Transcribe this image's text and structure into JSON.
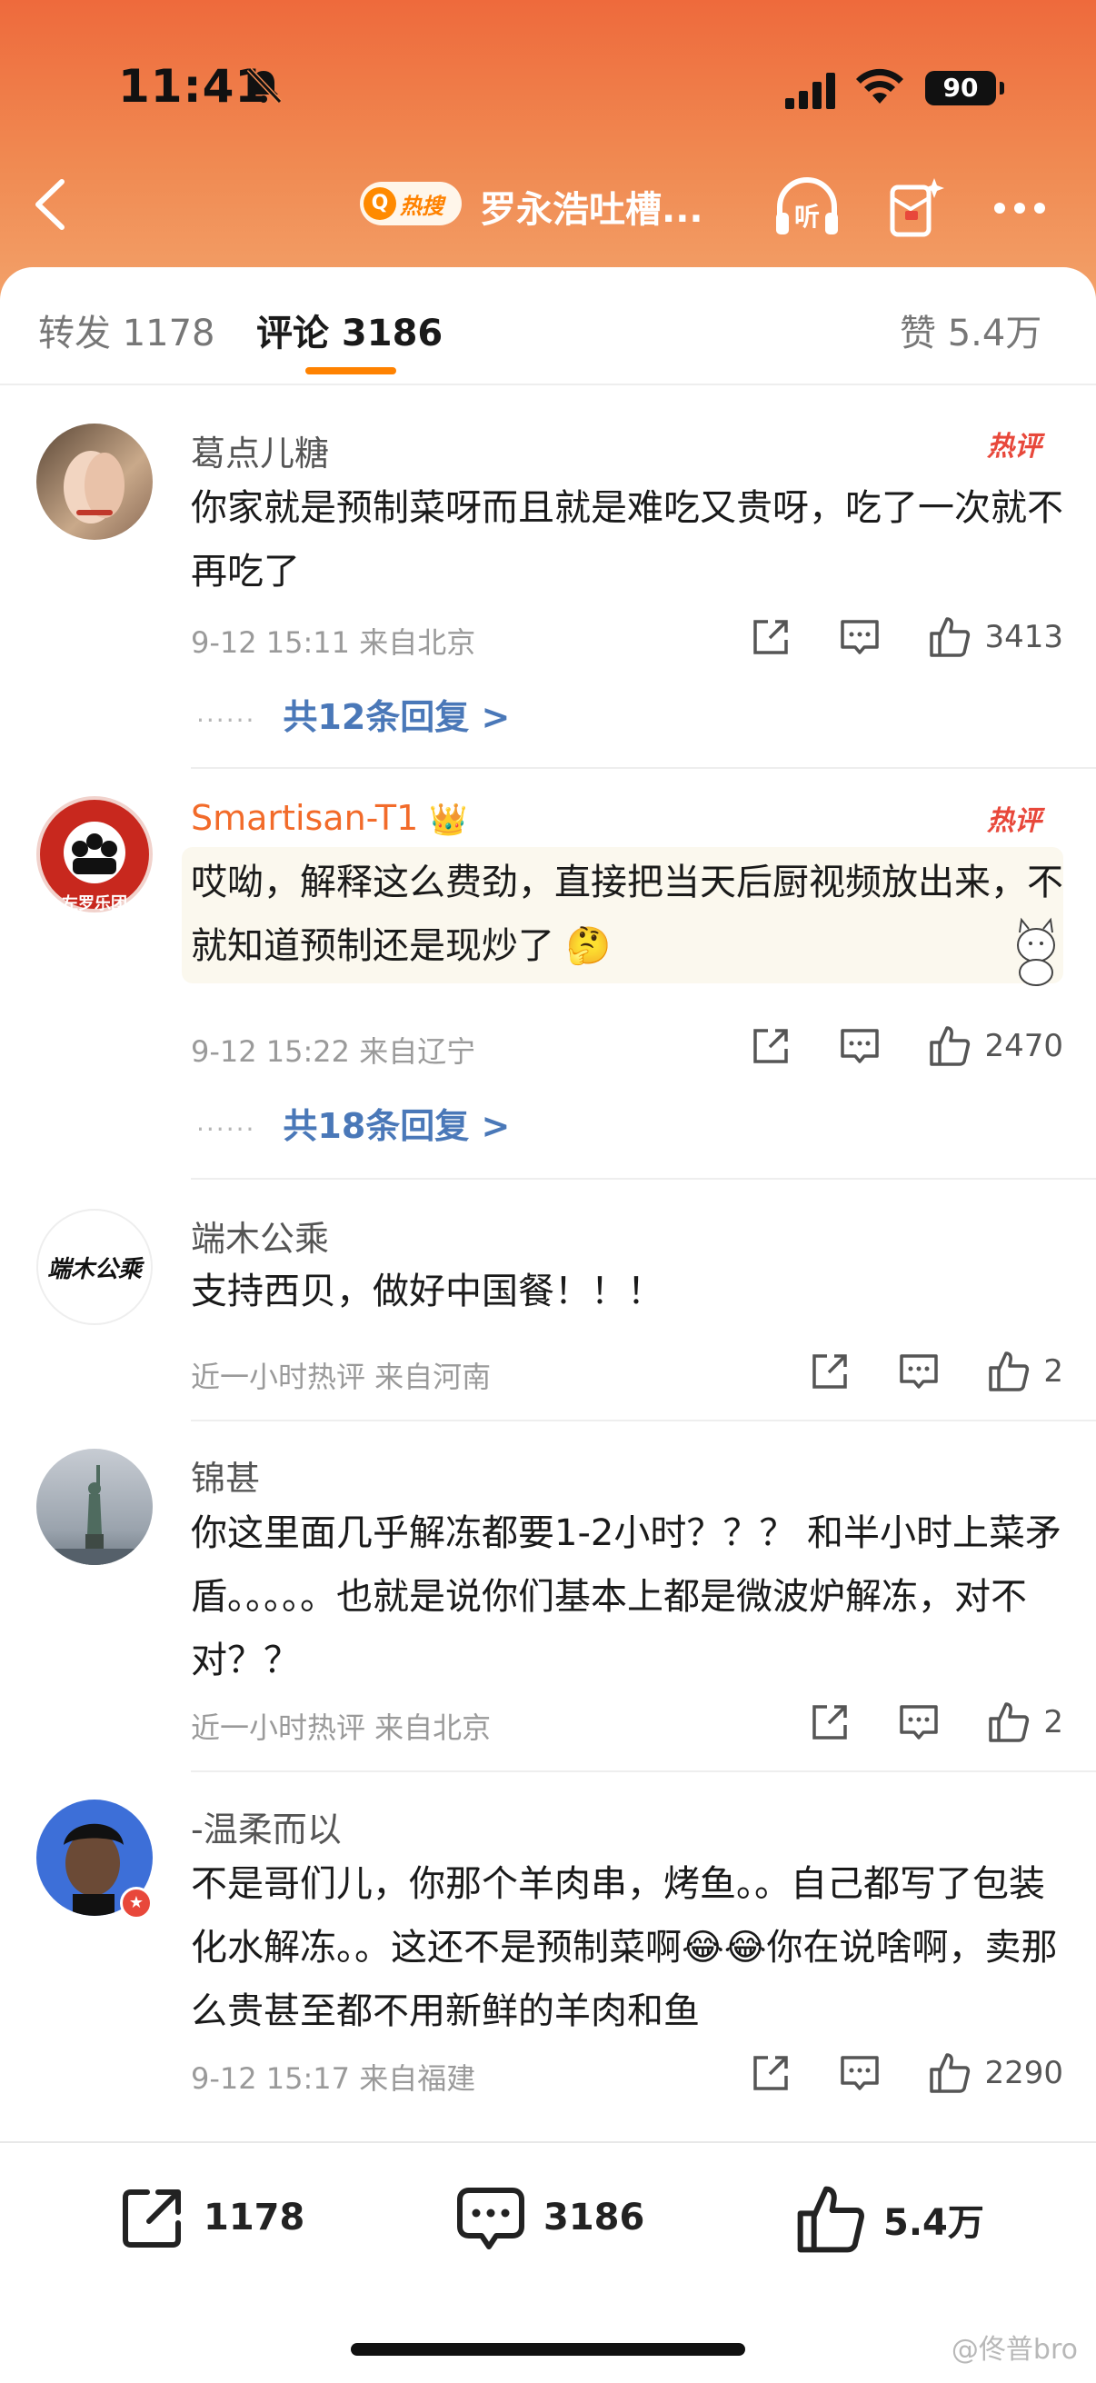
{
  "status_bar": {
    "time": "11:41",
    "battery": "90"
  },
  "nav": {
    "hot_label": "热搜",
    "title": "罗永浩吐槽...",
    "listen_label": "听"
  },
  "tabs": {
    "repost": "转发 1178",
    "comment": "评论 3186",
    "like": "赞 5.4万"
  },
  "colors": {
    "accent": "#ff8200",
    "link": "#4a78b8",
    "hot": "#e8483b",
    "header_gradient_top": "#ee6a3c"
  },
  "comments": [
    {
      "user": "葛点儿糖",
      "hot_badge": "热评",
      "text": "你家就是预制菜呀而且就是难吃又贵呀，吃了一次就不再吃了",
      "meta": "9-12 15:11  来自北京",
      "likes": "3413",
      "replies": "共12条回复 >"
    },
    {
      "user": "Smartisan-T1",
      "hot_badge": "热评",
      "text": "哎呦，解释这么费劲，直接把当天后厨视频放出来，不就知道预制还是现炒了",
      "meta": "9-12 15:22  来自辽宁",
      "likes": "2470",
      "replies": "共18条回复 >",
      "avatar_text": "左罗乐团"
    },
    {
      "user": "端木公乘",
      "text": "支持西贝，做好中国餐！！！",
      "meta": "近一小时热评  来自河南",
      "likes": "2",
      "avatar_text": "端木公乘"
    },
    {
      "user": "锦甚",
      "text": "你这里面几乎解冻都要1-2小时？？？ 和半小时上菜矛盾。。。。。也就是说你们基本上都是微波炉解冻，对不对？？",
      "meta": "近一小时热评  来自北京",
      "likes": "2"
    },
    {
      "user": "-温柔而以",
      "text": "不是哥们儿，你那个羊肉串，烤鱼。。自己都写了包装化水解冻。。这还不是预制菜啊😂😂你在说啥啊，卖那么贵甚至都不用新鲜的羊肉和鱼",
      "meta": "9-12 15:17  来自福建",
      "likes": "2290"
    }
  ],
  "bottom_bar": {
    "repost": "1178",
    "comment": "3186",
    "like": "5.4万"
  },
  "watermark": "@佟普bro"
}
